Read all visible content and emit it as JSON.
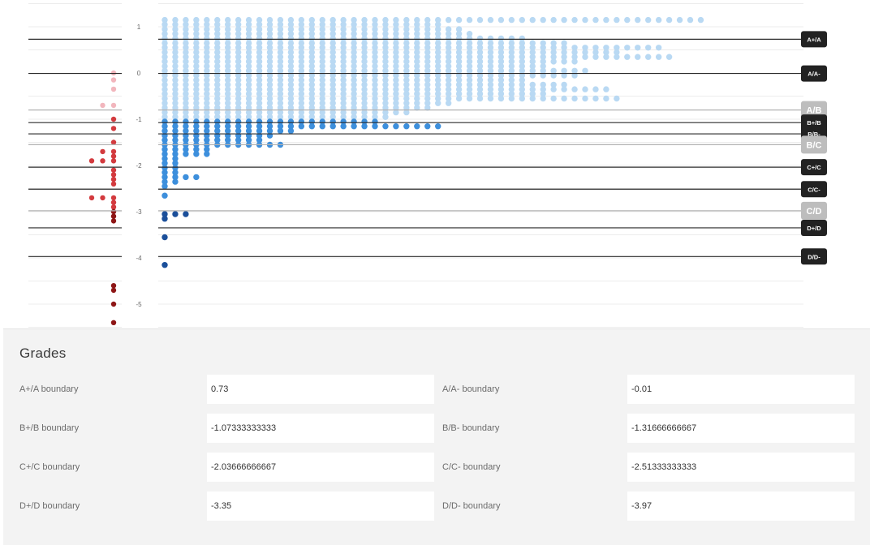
{
  "grades": {
    "title": "Grades",
    "fields": [
      {
        "label": "A+/A boundary",
        "value": "0.73"
      },
      {
        "label": "A/A- boundary",
        "value": "-0.01"
      },
      {
        "label": "B+/B boundary",
        "value": "-1.07333333333"
      },
      {
        "label": "B/B- boundary",
        "value": "-1.31666666667"
      },
      {
        "label": "C+/C boundary",
        "value": "-2.03666666667"
      },
      {
        "label": "C/C- boundary",
        "value": "-2.51333333333"
      },
      {
        "label": "D+/D boundary",
        "value": "-3.35"
      },
      {
        "label": "D/D- boundary",
        "value": "-3.97"
      }
    ]
  },
  "chart_data": {
    "type": "scatter",
    "y_ticks": [
      "1",
      "0",
      "-1",
      "-2",
      "-3",
      "-4",
      "-5"
    ],
    "ylim": [
      -5.5,
      1.25
    ],
    "colors": {
      "light_blue": "#b9d9f3",
      "mid_blue": "#3d8fdc",
      "dark_blue": "#1b4f9a",
      "pink": "#f2b6bd",
      "red": "#d33a3e",
      "dark_red": "#8e1616",
      "boundary_dark": "#2b2b2b",
      "boundary_light": "#b3b3b3"
    },
    "boundaries": [
      {
        "label": "A+/A",
        "value": 0.73,
        "style": "dark"
      },
      {
        "label": "A/A-",
        "value": -0.01,
        "style": "dark"
      },
      {
        "label": "A/B",
        "value": -0.8,
        "style": "light"
      },
      {
        "label": "B+/B",
        "value": -1.07333333333,
        "style": "dark"
      },
      {
        "label": "B/B-",
        "value": -1.31666666667,
        "style": "dark"
      },
      {
        "label": "B/C",
        "value": -1.55,
        "style": "light"
      },
      {
        "label": "C+/C",
        "value": -2.03666666667,
        "style": "dark"
      },
      {
        "label": "C/C-",
        "value": -2.51333333333,
        "style": "dark"
      },
      {
        "label": "C/D",
        "value": -2.98,
        "style": "light"
      },
      {
        "label": "D+/D",
        "value": -3.35,
        "style": "dark"
      },
      {
        "label": "D/D-",
        "value": -3.97,
        "style": "dark"
      }
    ],
    "histogram": {
      "bin_width": 0.1,
      "bins": [
        {
          "y": 1.2,
          "count": 52
        },
        {
          "y": 1.1,
          "count": 27
        },
        {
          "y": 1.0,
          "count": 29
        },
        {
          "y": 0.9,
          "count": 30
        },
        {
          "y": 0.8,
          "count": 35
        },
        {
          "y": 0.7,
          "count": 39
        },
        {
          "y": 0.6,
          "count": 48
        },
        {
          "y": 0.5,
          "count": 44
        },
        {
          "y": 0.4,
          "count": 49
        },
        {
          "y": 0.3,
          "count": 40
        },
        {
          "y": 0.2,
          "count": 37
        },
        {
          "y": 0.1,
          "count": 41
        },
        {
          "y": 0.0,
          "count": 40
        },
        {
          "y": -0.1,
          "count": 35
        },
        {
          "y": -0.2,
          "count": 39
        },
        {
          "y": -0.3,
          "count": 43
        },
        {
          "y": -0.4,
          "count": 37
        },
        {
          "y": -0.5,
          "count": 44
        },
        {
          "y": -0.6,
          "count": 28
        },
        {
          "y": -0.7,
          "count": 26
        },
        {
          "y": -0.8,
          "count": 24
        },
        {
          "y": -0.9,
          "count": 22
        },
        {
          "y": -1.0,
          "count": 21
        },
        {
          "y": -1.1,
          "count": 27
        },
        {
          "y": -1.2,
          "count": 13
        },
        {
          "y": -1.3,
          "count": 11
        },
        {
          "y": -1.4,
          "count": 10
        },
        {
          "y": -1.5,
          "count": 12
        },
        {
          "y": -1.6,
          "count": 5
        },
        {
          "y": -1.7,
          "count": 5
        },
        {
          "y": -1.8,
          "count": 2
        },
        {
          "y": -1.9,
          "count": 2
        },
        {
          "y": -2.0,
          "count": 2
        },
        {
          "y": -2.1,
          "count": 2
        },
        {
          "y": -2.2,
          "count": 4
        },
        {
          "y": -2.3,
          "count": 2
        },
        {
          "y": -2.4,
          "count": 1
        },
        {
          "y": -2.6,
          "count": 1
        },
        {
          "y": -3.0,
          "count": 3
        },
        {
          "y": -3.1,
          "count": 1
        },
        {
          "y": -3.5,
          "count": 1
        },
        {
          "y": -4.1,
          "count": 1
        }
      ]
    },
    "strip": {
      "points": [
        {
          "y": 0.0,
          "x": 0
        },
        {
          "y": -0.15,
          "x": 0
        },
        {
          "y": -0.35,
          "x": 0
        },
        {
          "y": -0.7,
          "x": -1
        },
        {
          "y": -0.7,
          "x": 0
        },
        {
          "y": -1.0,
          "x": 0
        },
        {
          "y": -1.2,
          "x": 0
        },
        {
          "y": -1.5,
          "x": 0
        },
        {
          "y": -1.7,
          "x": -1
        },
        {
          "y": -1.7,
          "x": 0
        },
        {
          "y": -1.8,
          "x": 0
        },
        {
          "y": -1.9,
          "x": -2
        },
        {
          "y": -1.9,
          "x": -1
        },
        {
          "y": -1.9,
          "x": 0
        },
        {
          "y": -2.1,
          "x": 0
        },
        {
          "y": -2.2,
          "x": 0
        },
        {
          "y": -2.3,
          "x": 0
        },
        {
          "y": -2.4,
          "x": 0
        },
        {
          "y": -2.7,
          "x": -2
        },
        {
          "y": -2.7,
          "x": -1
        },
        {
          "y": -2.7,
          "x": 0
        },
        {
          "y": -2.8,
          "x": 0
        },
        {
          "y": -2.9,
          "x": 0
        },
        {
          "y": -3.0,
          "x": 0
        },
        {
          "y": -3.1,
          "x": 0
        },
        {
          "y": -3.2,
          "x": 0
        },
        {
          "y": -4.6,
          "x": 0
        },
        {
          "y": -4.7,
          "x": 0
        },
        {
          "y": -5.0,
          "x": 0
        },
        {
          "y": -5.4,
          "x": 0
        }
      ]
    }
  }
}
